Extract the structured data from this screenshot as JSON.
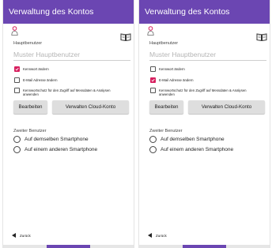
{
  "colors": {
    "appbar": "#6b46b2",
    "checkbox_checked": "#d7205f",
    "button_bg": "#dedede",
    "placeholder": "#b5b5b5"
  },
  "screens": [
    {
      "title": "Verwaltung des Kontos",
      "icons": [
        "user-icon",
        "book-icon"
      ],
      "main_user_label": "Hauptbenutzer",
      "main_user_placeholder": "Muster Hauptbenutzer",
      "checkboxes": [
        {
          "label": "Kennwort ändern",
          "checked": true
        },
        {
          "label": "E-Mail Adresse ändern",
          "checked": false
        },
        {
          "label_line1": "Kennwortschutz für den Zugriff auf Messdaten & Analysen",
          "label_line2": "anwenden",
          "checked": false
        }
      ],
      "buttons": {
        "edit": "Bearbeiten",
        "cloud": "Verwalten Cloud-Konto"
      },
      "second_user_label": "Zweiter Benutzer",
      "radio_options": [
        "Auf demselben Smartphone",
        "Auf einem anderen Smartphone"
      ],
      "back_label": "Zurück"
    },
    {
      "title": "Verwaltung des Kontos",
      "icons": [
        "user-icon",
        "book-icon"
      ],
      "main_user_label": "Hauptbenutzer",
      "main_user_placeholder": "Muster Hauptbenutzer",
      "checkboxes": [
        {
          "label": "Kennwort ändern",
          "checked": false
        },
        {
          "label": "E-Mail Adresse ändern",
          "checked": true
        },
        {
          "label_line1": "Kennwortschutz für den Zugriff auf Messdaten & Analysen",
          "label_line2": "anwenden",
          "checked": false
        }
      ],
      "buttons": {
        "edit": "Bearbeiten",
        "cloud": "Verwalten Cloud-Konto"
      },
      "second_user_label": "Zweiter Benutzer",
      "radio_options": [
        "Auf demselben Smartphone",
        "Auf einem anderen Smartphone"
      ],
      "back_label": "Zurück"
    }
  ]
}
